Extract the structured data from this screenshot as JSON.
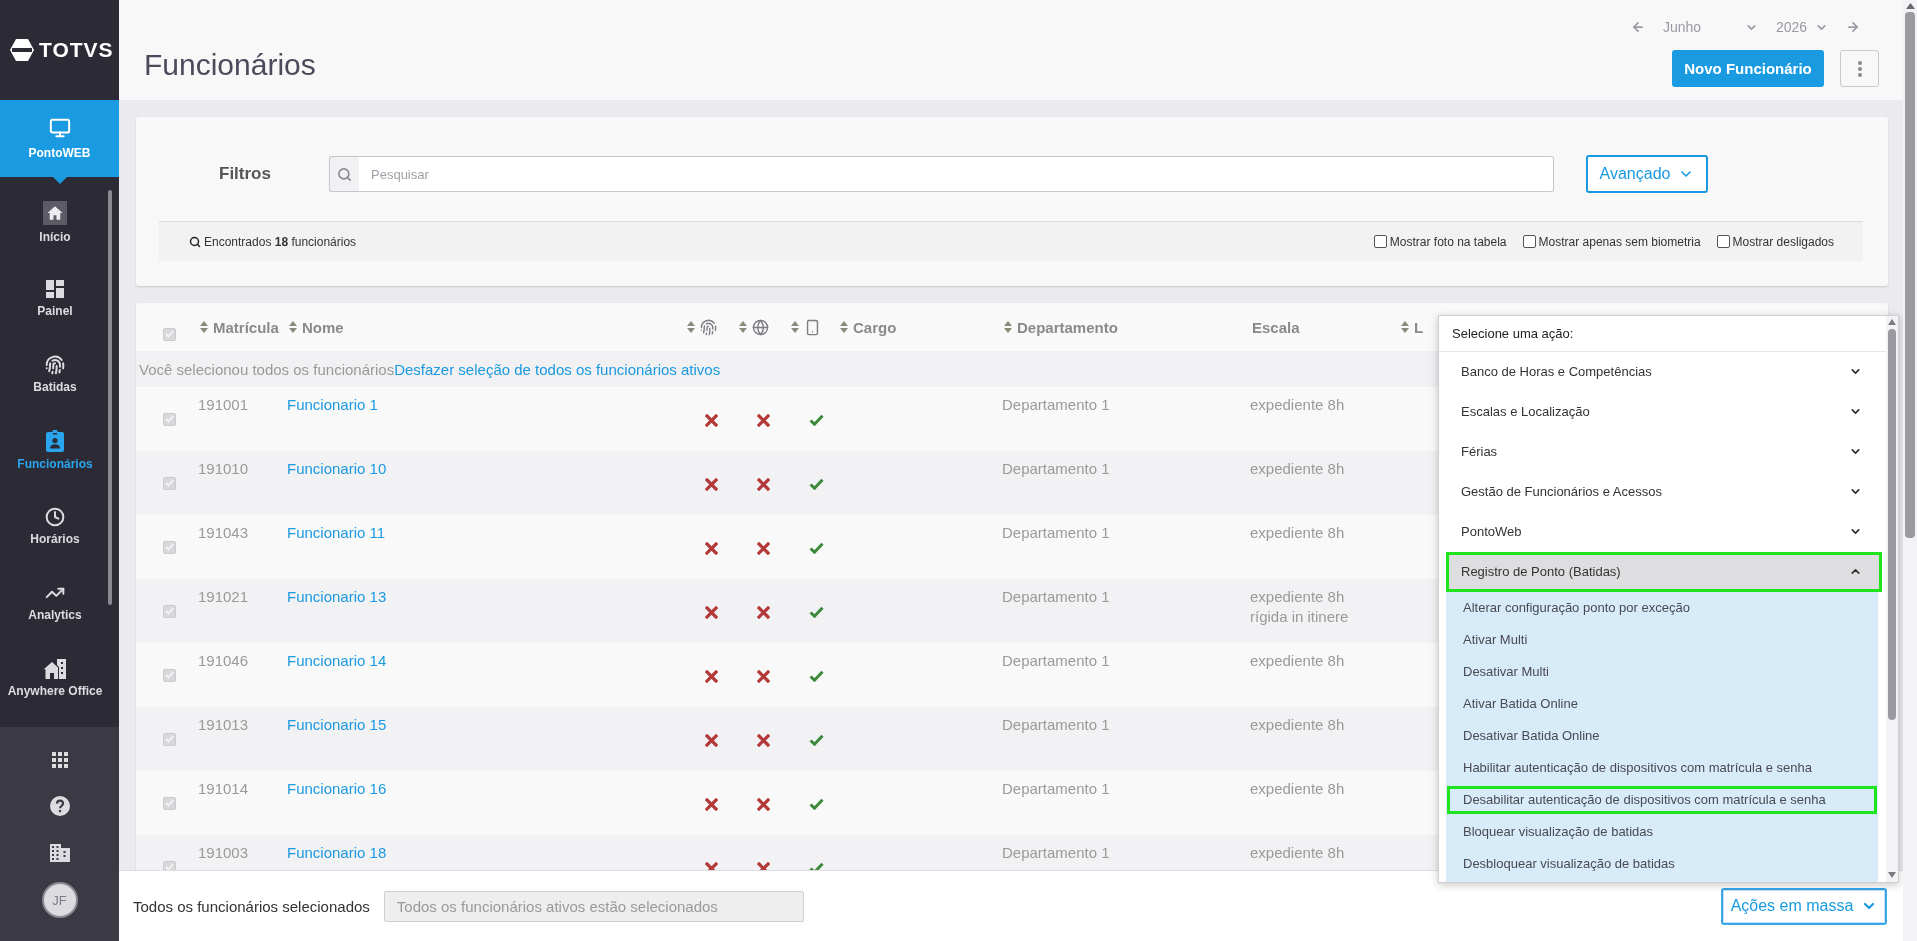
{
  "sidebar": {
    "logo": "TOTVS",
    "module": "PontoWEB",
    "items": [
      {
        "label": "Início",
        "selected": false
      },
      {
        "label": "Painel",
        "selected": false
      },
      {
        "label": "Batidas",
        "selected": false
      },
      {
        "label": "Funcionários",
        "selected": true
      },
      {
        "label": "Horários",
        "selected": false
      },
      {
        "label": "Analytics",
        "selected": false
      },
      {
        "label": "Anywhere Office",
        "selected": false
      }
    ],
    "avatar": "JF"
  },
  "header": {
    "title": "Funcionários",
    "month": "Junho",
    "year": "2026",
    "primary_button": "Novo Funcionário"
  },
  "filters": {
    "label": "Filtros",
    "search": {
      "placeholder": "Pesquisar"
    },
    "advanced_button": "Avançado",
    "summary": "Encontrados **18** funcionários",
    "options": [
      {
        "label": "Mostrar foto na tabela",
        "checked": false
      },
      {
        "label": "Mostrar apenas sem biometria",
        "checked": false
      },
      {
        "label": "Mostrar desligados",
        "checked": false
      }
    ]
  },
  "table": {
    "select_all": {
      "checked": true
    },
    "columns": [
      {
        "kind": "text",
        "label": "Matrícula",
        "sortable": true
      },
      {
        "kind": "text",
        "label": "Nome",
        "sortable": true
      },
      {
        "kind": "icon",
        "sortable": true
      },
      {
        "kind": "icon",
        "sortable": true
      },
      {
        "kind": "icon",
        "sortable": true
      },
      {
        "kind": "text",
        "label": "Cargo",
        "sortable": true
      },
      {
        "kind": "text",
        "label": "Departamento",
        "sortable": true
      },
      {
        "kind": "text",
        "label": "Escala",
        "sortable": false
      },
      {
        "kind": "text",
        "label": "L",
        "sortable": true
      }
    ],
    "selection_notice": {
      "text": "Você selecionou todos os funcionários",
      "link": "Desfazer seleção de todos os funcionários ativos"
    },
    "rows": [
      {
        "checked": true,
        "matricula": "191001",
        "nome": "Funcionario 1",
        "status": [
          false,
          false,
          true
        ],
        "departamento": "Departamento 1",
        "escala": [
          "expediente 8h"
        ]
      },
      {
        "checked": true,
        "matricula": "191010",
        "nome": "Funcionario 10",
        "status": [
          false,
          false,
          true
        ],
        "departamento": "Departamento 1",
        "escala": [
          "expediente 8h"
        ]
      },
      {
        "checked": true,
        "matricula": "191043",
        "nome": "Funcionario 11",
        "status": [
          false,
          false,
          true
        ],
        "departamento": "Departamento 1",
        "escala": [
          "expediente 8h"
        ]
      },
      {
        "checked": true,
        "matricula": "191021",
        "nome": "Funcionario 13",
        "status": [
          false,
          false,
          true
        ],
        "departamento": "Departamento 1",
        "escala": [
          "expediente 8h",
          "rígida in itinere"
        ]
      },
      {
        "checked": true,
        "matricula": "191046",
        "nome": "Funcionario 14",
        "status": [
          false,
          false,
          true
        ],
        "departamento": "Departamento 1",
        "escala": [
          "expediente 8h"
        ]
      },
      {
        "checked": true,
        "matricula": "191013",
        "nome": "Funcionario 15",
        "status": [
          false,
          false,
          true
        ],
        "departamento": "Departamento 1",
        "escala": [
          "expediente 8h"
        ]
      },
      {
        "checked": true,
        "matricula": "191014",
        "nome": "Funcionario 16",
        "status": [
          false,
          false,
          true
        ],
        "departamento": "Departamento 1",
        "escala": [
          "expediente 8h"
        ]
      },
      {
        "checked": true,
        "matricula": "191003",
        "nome": "Funcionario 18",
        "status": [
          false,
          false,
          true
        ],
        "departamento": "Departamento 1",
        "escala": [
          "expediente 8h"
        ]
      }
    ]
  },
  "footer": {
    "label": "Todos os funcionários selecionados",
    "field": {
      "value": "Todos os funcionários ativos estão selecionados"
    },
    "bulk_button": "Ações em massa"
  },
  "action_menu": {
    "title": "Selecione uma ação:",
    "sections": [
      {
        "label": "Banco de Horas e Competências",
        "expanded": false,
        "highlighted": false
      },
      {
        "label": "Escalas e Localização",
        "expanded": false,
        "highlighted": false
      },
      {
        "label": "Férias",
        "expanded": false,
        "highlighted": false
      },
      {
        "label": "Gestão de Funcionários e Acessos",
        "expanded": false,
        "highlighted": false
      },
      {
        "label": "PontoWeb",
        "expanded": false,
        "highlighted": false
      },
      {
        "label": "Registro de Ponto (Batidas)",
        "expanded": true,
        "highlighted": true,
        "actions": [
          {
            "label": "Alterar configuração ponto por exceção",
            "highlighted": false
          },
          {
            "label": "Ativar Multi",
            "highlighted": false
          },
          {
            "label": "Desativar Multi",
            "highlighted": false
          },
          {
            "label": "Ativar Batida Online",
            "highlighted": false
          },
          {
            "label": "Desativar Batida Online",
            "highlighted": false
          },
          {
            "label": "Habilitar autenticação de dispositivos com matrícula e senha",
            "highlighted": false
          },
          {
            "label": "Desabilitar autenticação de dispositivos com matrícula e senha",
            "highlighted": true
          },
          {
            "label": "Bloquear visualização de batidas",
            "highlighted": false
          },
          {
            "label": "Desbloquear visualização de batidas",
            "highlighted": false
          }
        ]
      }
    ]
  }
}
